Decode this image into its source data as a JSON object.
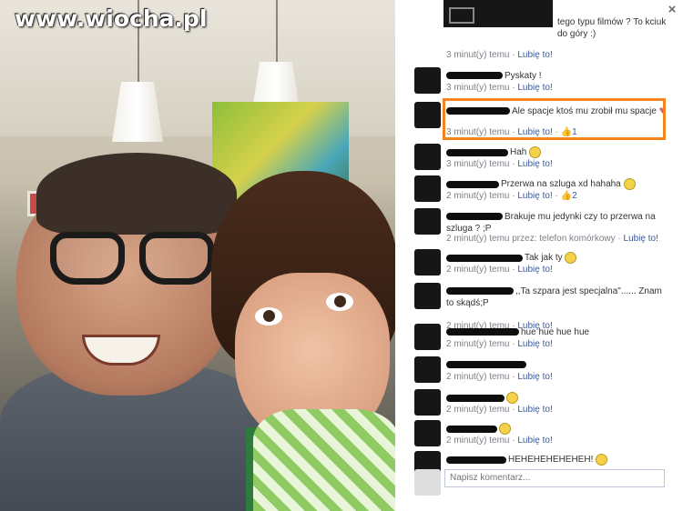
{
  "watermark": "www.wiocha.pl",
  "panel": {
    "close_label": "×",
    "first_text": "tego typu filmów ? To kciuk do góry :)",
    "first_meta": {
      "time": "3 minut(y) temu",
      "sep": " · ",
      "like": "Lubię to!"
    }
  },
  "comments": [
    {
      "name": "Pyskaty !",
      "time": "3 minut(y) temu",
      "like": "Lubię to!",
      "count": ""
    },
    {
      "name": "Ale spacje ktoś mu zrobił mu spacje",
      "time": "3 minut(y) temu",
      "like": "Lubię to!",
      "count": "1"
    },
    {
      "name": "Hah",
      "time": "3 minut(y) temu",
      "like": "Lubię to!",
      "count": ""
    },
    {
      "name": "Przerwa na szluga xd hahaha",
      "time": "2 minut(y) temu",
      "like": "Lubię to!",
      "count": "2"
    },
    {
      "name": "Brakuje mu jedynki czy to przerwa na szluga ? ;P",
      "time": "2 minut(y) temu przez: telefon komórkowy",
      "like": "Lubię to!",
      "count": ""
    },
    {
      "name": "Tak jak ty",
      "time": "2 minut(y) temu",
      "like": "Lubię to!",
      "count": ""
    },
    {
      "name": ",,Ta szpara jest specjalna\"...... Znam to skądś;P",
      "time": "2 minut(y) temu",
      "like": "Lubię to!",
      "count": ""
    },
    {
      "name": "hue hue hue hue",
      "time": "2 minut(y) temu",
      "like": "Lubię to!",
      "count": ""
    },
    {
      "name": "",
      "time": "2 minut(y) temu",
      "like": "Lubię to!",
      "count": ""
    },
    {
      "name": "",
      "time": "2 minut(y) temu",
      "like": "Lubię to!",
      "count": ""
    },
    {
      "name": "",
      "time": "2 minut(y) temu",
      "like": "Lubię to!",
      "count": ""
    },
    {
      "name": "HEHEHEHEHEHEH!",
      "time": "",
      "like": "",
      "count": ""
    }
  ],
  "compose": {
    "placeholder": "Napisz komentarz..."
  },
  "colors": {
    "link": "#3b5998",
    "highlight": "#f5841f"
  }
}
